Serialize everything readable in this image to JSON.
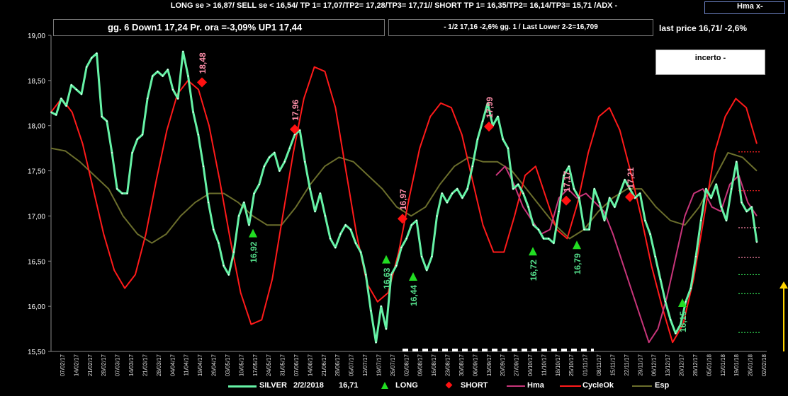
{
  "header": {
    "signal_text": "LONG se > 16,87/  SELL se < 16,54/ TP 1= 17,07/TP2= 17,28/TP3= 17,71//   SHORT TP 1= 16,35/TP2= 16,14/TP3= 15,71 /ADX -",
    "hma_label": "Hma x-"
  },
  "info": {
    "status_line": "gg. 6  Down1  17,24  Pr. ora =-3,09%   UP1 17,44",
    "cycle_line": "-  1/2   17,16  -2,6%  gg. 1 / Last Lower 2-2=16,709",
    "last_price": "last price 16,71/  -2,6%",
    "incerto": "incerto -"
  },
  "legend": {
    "silver": "SILVER",
    "date": "2/2/2018",
    "price": "16,71",
    "long": "LONG",
    "short": "SHORT",
    "hma": "Hma",
    "cycle": "CycleOk",
    "esp": "Esp"
  },
  "colors": {
    "silver": "#66f2a6",
    "cycle": "#ff1a1a",
    "hma": "#c8357a",
    "esp": "#6b6e2c",
    "long": "#22dd22",
    "short": "#ff1111",
    "annotation_long": "#55e08c",
    "annotation_short": "#ff8faa"
  },
  "chart_data": {
    "type": "line",
    "ylim": [
      15.5,
      19.0
    ],
    "y_ticks": [
      "19,00",
      "18,50",
      "18,00",
      "17,50",
      "17,00",
      "16,50",
      "16,00",
      "15,50"
    ],
    "x_tick_labels": [
      "07/02/17",
      "14/02/17",
      "21/02/17",
      "28/02/17",
      "07/03/17",
      "14/03/17",
      "21/03/17",
      "28/03/17",
      "04/04/17",
      "11/04/17",
      "19/04/17",
      "26/04/17",
      "03/05/17",
      "10/05/17",
      "17/05/17",
      "24/05/17",
      "31/05/17",
      "07/06/17",
      "14/06/17",
      "21/06/17",
      "28/06/17",
      "05/07/17",
      "12/07/17",
      "19/07/17",
      "26/07/17",
      "02/08/17",
      "09/08/17",
      "16/08/17",
      "23/08/17",
      "30/08/17",
      "06/09/17",
      "13/09/17",
      "20/09/17",
      "27/09/17",
      "04/10/17",
      "11/10/17",
      "18/10/17",
      "25/10/17",
      "01/11/17",
      "08/11/17",
      "15/11/17",
      "22/11/17",
      "29/11/17",
      "06/12/17",
      "13/12/17",
      "20/12/17",
      "28/12/17",
      "05/01/18",
      "12/01/18",
      "19/01/18",
      "26/01/18",
      "02/02/18"
    ],
    "series": [
      {
        "name": "SILVER",
        "values": [
          18.15,
          18.12,
          18.3,
          18.22,
          18.45,
          18.4,
          18.35,
          18.65,
          18.75,
          18.8,
          18.1,
          18.05,
          17.7,
          17.3,
          17.25,
          17.25,
          17.7,
          17.85,
          17.9,
          18.3,
          18.55,
          18.6,
          18.55,
          18.62,
          18.4,
          18.3,
          18.82,
          18.55,
          18.15,
          17.9,
          17.55,
          17.15,
          16.85,
          16.7,
          16.45,
          16.35,
          16.6,
          17.0,
          17.15,
          16.9,
          17.25,
          17.35,
          17.55,
          17.65,
          17.7,
          17.5,
          17.6,
          17.75,
          17.9,
          17.95,
          17.6,
          17.3,
          17.05,
          17.25,
          17.0,
          16.75,
          16.65,
          16.8,
          16.9,
          16.85,
          16.7,
          16.6,
          16.35,
          15.95,
          15.6,
          16.0,
          15.75,
          16.35,
          16.45,
          16.65,
          16.75,
          16.9,
          16.95,
          16.55,
          16.4,
          16.55,
          17.0,
          17.25,
          17.15,
          17.25,
          17.3,
          17.2,
          17.3,
          17.55,
          17.85,
          18.05,
          18.25,
          18.0,
          18.1,
          17.85,
          17.75,
          17.3,
          17.35,
          17.25,
          17.1,
          16.9,
          16.85,
          16.75,
          16.75,
          16.7,
          17.05,
          17.45,
          17.55,
          17.3,
          17.2,
          16.85,
          16.85,
          17.3,
          17.15,
          16.95,
          17.2,
          17.1,
          17.25,
          17.4,
          17.3,
          17.2,
          17.25,
          16.95,
          16.8,
          16.55,
          16.3,
          16.05,
          15.85,
          15.7,
          15.8,
          16.05,
          16.2,
          16.55,
          16.95,
          17.3,
          17.2,
          17.35,
          17.1,
          16.95,
          17.3,
          17.6,
          17.15,
          17.05,
          17.1,
          16.71
        ]
      },
      {
        "name": "CycleOk",
        "values": [
          18.15,
          18.3,
          18.15,
          17.8,
          17.3,
          16.8,
          16.4,
          16.2,
          16.35,
          16.8,
          17.4,
          17.95,
          18.35,
          18.5,
          18.4,
          18.0,
          17.4,
          16.75,
          16.15,
          15.8,
          15.85,
          16.3,
          17.0,
          17.7,
          18.3,
          18.65,
          18.6,
          18.2,
          17.5,
          16.8,
          16.25,
          16.05,
          16.15,
          16.6,
          17.2,
          17.75,
          18.1,
          18.25,
          18.2,
          17.9,
          17.4,
          16.9,
          16.6,
          16.6,
          17.0,
          17.45,
          17.55,
          17.2,
          16.85,
          16.75,
          17.15,
          17.7,
          18.1,
          18.2,
          17.95,
          17.5,
          17.0,
          16.45,
          16.0,
          15.6,
          15.8,
          16.3,
          17.0,
          17.7,
          18.1,
          18.3,
          18.2,
          17.8
        ]
      },
      {
        "name": "Esp",
        "values": [
          17.75,
          17.72,
          17.6,
          17.45,
          17.3,
          17.0,
          16.8,
          16.7,
          16.8,
          17.0,
          17.15,
          17.25,
          17.25,
          17.15,
          17.0,
          16.9,
          16.9,
          17.1,
          17.35,
          17.55,
          17.65,
          17.6,
          17.45,
          17.3,
          17.1,
          17.0,
          17.1,
          17.35,
          17.55,
          17.65,
          17.6,
          17.6,
          17.5,
          17.3,
          17.1,
          16.9,
          16.75,
          16.85,
          17.05,
          17.2,
          17.3,
          17.3,
          17.1,
          16.95,
          16.9,
          17.1,
          17.4,
          17.7,
          17.65,
          17.5
        ]
      },
      {
        "name": "Hma",
        "values": [
          17.45,
          17.55,
          17.35,
          17.1,
          16.95,
          16.8,
          16.85,
          17.2,
          17.3,
          17.2,
          17.25,
          17.15,
          17.05,
          16.8,
          16.5,
          16.2,
          15.9,
          15.6,
          15.75,
          16.1,
          16.55,
          17.0,
          17.25,
          17.3,
          17.1,
          17.05,
          17.35,
          17.45,
          17.15,
          17.0
        ]
      }
    ],
    "long_signals": [
      {
        "price": 16.92,
        "label": "16,92"
      },
      {
        "price": 16.63,
        "label": "16,63"
      },
      {
        "price": 16.44,
        "label": "16,44"
      },
      {
        "price": 16.72,
        "label": "16,72"
      },
      {
        "price": 16.79,
        "label": "16,79"
      },
      {
        "price": 16.15,
        "label": "16,15"
      }
    ],
    "short_signals": [
      {
        "price": 18.48,
        "label": "18,48"
      },
      {
        "price": 17.96,
        "label": "17,96"
      },
      {
        "price": 16.97,
        "label": "16,97"
      },
      {
        "price": 17.99,
        "label": "17,99"
      },
      {
        "price": 17.17,
        "label": "17,17"
      },
      {
        "price": 17.21,
        "label": "17,21"
      }
    ],
    "target_levels": [
      17.71,
      17.28,
      16.87,
      16.54,
      16.35,
      16.14,
      15.71
    ]
  }
}
